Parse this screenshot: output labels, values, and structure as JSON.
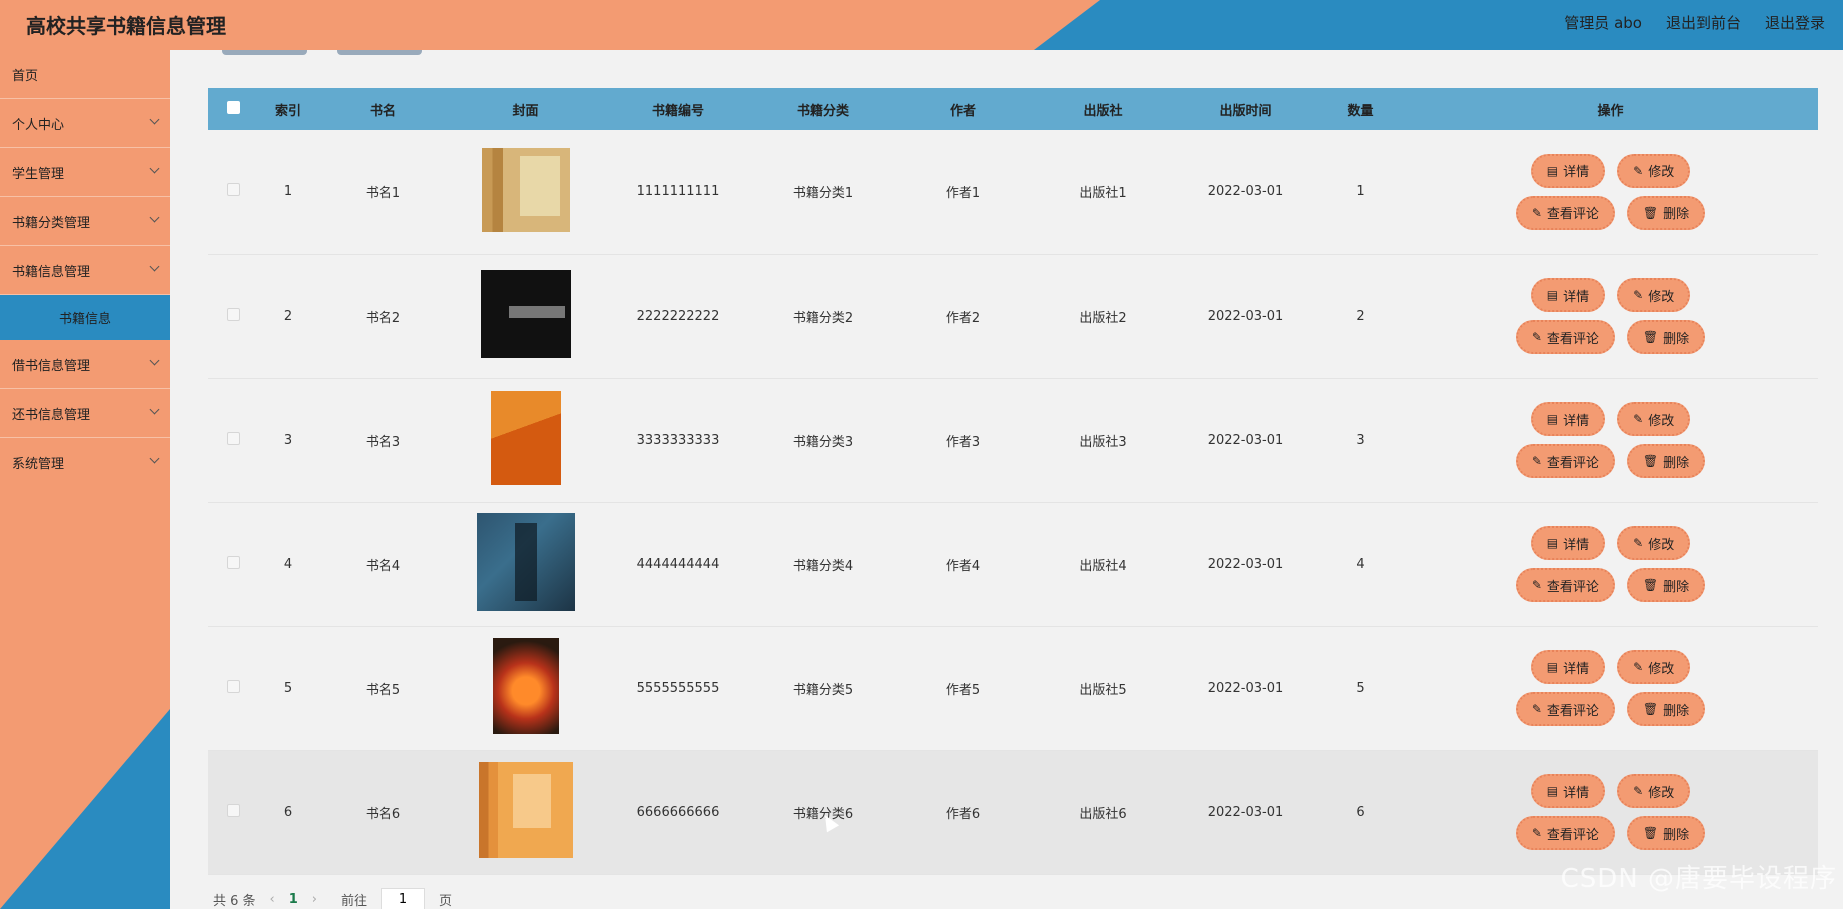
{
  "header": {
    "title": "高校共享书籍信息管理",
    "user": "管理员 abo",
    "frontend_link": "退出到前台",
    "logout": "退出登录"
  },
  "sidebar": {
    "items": [
      {
        "label": "首页"
      },
      {
        "label": "个人中心"
      },
      {
        "label": "学生管理"
      },
      {
        "label": "书籍分类管理"
      },
      {
        "label": "书籍信息管理"
      },
      {
        "label": "借书信息管理"
      },
      {
        "label": "还书信息管理"
      },
      {
        "label": "系统管理"
      }
    ],
    "sub_active": "书籍信息"
  },
  "table": {
    "headers": [
      "索引",
      "书名",
      "封面",
      "书籍编号",
      "书籍分类",
      "作者",
      "出版社",
      "出版时间",
      "数量",
      "操作"
    ],
    "rows": [
      {
        "index": "1",
        "name": "书名1",
        "code": "1111111111",
        "category": "书籍分类1",
        "author": "作者1",
        "publisher": "出版社1",
        "date": "2022-03-01",
        "qty": "1"
      },
      {
        "index": "2",
        "name": "书名2",
        "code": "2222222222",
        "category": "书籍分类2",
        "author": "作者2",
        "publisher": "出版社2",
        "date": "2022-03-01",
        "qty": "2"
      },
      {
        "index": "3",
        "name": "书名3",
        "code": "3333333333",
        "category": "书籍分类3",
        "author": "作者3",
        "publisher": "出版社3",
        "date": "2022-03-01",
        "qty": "3"
      },
      {
        "index": "4",
        "name": "书名4",
        "code": "4444444444",
        "category": "书籍分类4",
        "author": "作者4",
        "publisher": "出版社4",
        "date": "2022-03-01",
        "qty": "4"
      },
      {
        "index": "5",
        "name": "书名5",
        "code": "5555555555",
        "category": "书籍分类5",
        "author": "作者5",
        "publisher": "出版社5",
        "date": "2022-03-01",
        "qty": "5"
      },
      {
        "index": "6",
        "name": "书名6",
        "code": "6666666666",
        "category": "书籍分类6",
        "author": "作者6",
        "publisher": "出版社6",
        "date": "2022-03-01",
        "qty": "6"
      }
    ],
    "actions": {
      "detail": "详情",
      "edit": "修改",
      "comments": "查看评论",
      "delete": "删除"
    }
  },
  "pager": {
    "total": "共 6 条",
    "current_page": "1",
    "goto_label": "前往",
    "page_input": "1",
    "page_suffix": "页"
  },
  "watermark": "CSDN @唐要毕设程序",
  "colors": {
    "accent_orange": "#f39b72",
    "accent_blue": "#2a8bc0",
    "table_head": "#62aacf"
  }
}
